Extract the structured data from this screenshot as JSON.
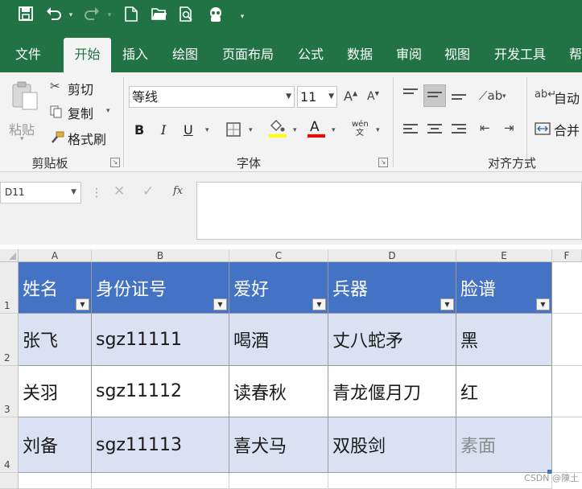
{
  "quick_access": {
    "save_icon": "save-icon",
    "undo_icon": "undo-icon",
    "redo_icon": "redo-icon",
    "new_icon": "new-file-icon",
    "open_icon": "open-folder-icon",
    "preview_icon": "print-preview-icon",
    "customize_icon": "customize-qat-icon"
  },
  "tabs": [
    "文件",
    "开始",
    "插入",
    "绘图",
    "页面布局",
    "公式",
    "数据",
    "审阅",
    "视图",
    "开发工具",
    "帮"
  ],
  "active_tab": "开始",
  "clipboard": {
    "paste_label": "粘贴",
    "cut_label": "剪切",
    "copy_label": "复制",
    "format_painter_label": "格式刷",
    "group_label": "剪贴板"
  },
  "font": {
    "font_name": "等线",
    "font_size": "11",
    "bold": "B",
    "italic": "I",
    "underline": "U",
    "font_color_glyph": "A",
    "phonetic_glyph": "wén文",
    "group_label": "字体",
    "fill_color": "#ffff00",
    "text_color": "#ff0000"
  },
  "alignment": {
    "wrap_label": "自动",
    "merge_label": "合并",
    "group_label": "对齐方式"
  },
  "formula_bar": {
    "name_box": "D11",
    "fx_label": "fx",
    "formula": ""
  },
  "columns": [
    "A",
    "B",
    "C",
    "D",
    "E",
    "F"
  ],
  "rows": [
    "1",
    "2",
    "3",
    "4"
  ],
  "table": {
    "headers": [
      "姓名",
      "身份证号",
      "爱好",
      "兵器",
      "脸谱"
    ],
    "rows": [
      [
        "张飞",
        "sgz11111",
        "喝酒",
        "丈八蛇矛",
        "黑"
      ],
      [
        "关羽",
        "sgz11112",
        "读春秋",
        "青龙偃月刀",
        "红"
      ],
      [
        "刘备",
        "sgz11113",
        "喜犬马",
        "双股剑",
        "素面"
      ]
    ],
    "header_color": "#4472c4",
    "band_color": "#d9e1f2"
  },
  "watermark": "CSDN @陳土"
}
